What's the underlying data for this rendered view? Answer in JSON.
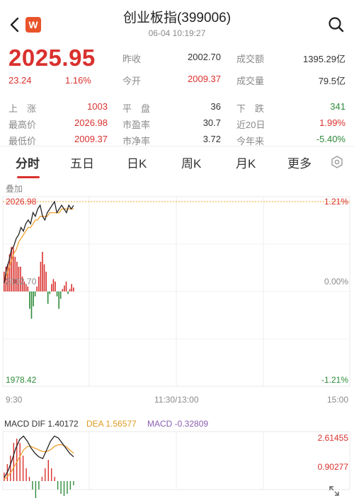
{
  "header": {
    "title": "创业板指(399006)",
    "subtitle": "06-04 10:19:27",
    "logo": "W",
    "back_icon": "chevron-left-icon",
    "search_icon": "search-icon"
  },
  "quote": {
    "price": "2025.95",
    "change": "23.24",
    "change_pct": "1.16%",
    "stats": [
      {
        "label": "昨收",
        "value": "2002.70",
        "color": "dark"
      },
      {
        "label": "成交额",
        "value": "1395.29亿",
        "color": "dark"
      },
      {
        "label": "今开",
        "value": "2009.37",
        "color": "red"
      },
      {
        "label": "成交量",
        "value": "79.5亿",
        "color": "dark"
      }
    ],
    "grid": [
      [
        {
          "label": "上　涨",
          "value": "1003",
          "color": "red"
        },
        {
          "label": "平　盘",
          "value": "36",
          "color": "dark"
        },
        {
          "label": "下　跌",
          "value": "341",
          "color": "green"
        }
      ],
      [
        {
          "label": "最高价",
          "value": "2026.98",
          "color": "red"
        },
        {
          "label": "市盈率",
          "value": "30.7",
          "color": "dark"
        },
        {
          "label": "近20日",
          "value": "1.99%",
          "color": "red"
        }
      ],
      [
        {
          "label": "最低价",
          "value": "2009.37",
          "color": "red"
        },
        {
          "label": "市净率",
          "value": "3.72",
          "color": "dark"
        },
        {
          "label": "今年来",
          "value": "-5.40%",
          "color": "green"
        }
      ]
    ]
  },
  "tabs": {
    "items": [
      "分时",
      "五日",
      "日K",
      "周K",
      "月K",
      "更多"
    ],
    "active": 0,
    "settings_icon": "hexagon-settings-icon"
  },
  "chart": {
    "overlay_label": "叠加",
    "y_top": "2026.98",
    "y_mid": "2002.70",
    "y_bottom": "1978.42",
    "pct_top": "1.21%",
    "pct_mid": "0.00%",
    "pct_bottom": "-1.21%",
    "time_start": "9:30",
    "time_mid": "11:30/13:00",
    "time_end": "15:00",
    "macd_dif": "MACD DIF 1.40172",
    "macd_dea": "DEA 1.56577",
    "macd_val": "MACD -0.32809",
    "macd_top": "2.61455",
    "macd_mid": "0.90277",
    "expand_icon": "expand-arrows-icon",
    "colors": {
      "up": "#d9312e",
      "down": "#2e8b3a",
      "price": "#222222",
      "avg": "#f0a030",
      "dea": "#f0a030",
      "macd": "#8a5fb0"
    }
  },
  "chart_data": {
    "type": "line",
    "price_series": [
      2005,
      2009,
      2011,
      2014,
      2015,
      2017,
      2018,
      2020,
      2019,
      2021,
      2022,
      2021,
      2024,
      2023,
      2025,
      2026,
      2023,
      2022,
      2024,
      2025,
      2026,
      2026.98,
      2024,
      2025,
      2026,
      2025,
      2024,
      2026,
      2025,
      2025.95
    ],
    "avg_series": [
      2006,
      2007,
      2009,
      2011,
      2013,
      2014,
      2016,
      2017,
      2018,
      2019,
      2020,
      2020,
      2021,
      2022,
      2022,
      2023,
      2023,
      2023,
      2023,
      2024,
      2024,
      2024,
      2024,
      2024,
      2025,
      2025,
      2025,
      2025,
      2025,
      2025
    ],
    "volume_bars": [
      0.4,
      0.5,
      0.55,
      0.75,
      0.9,
      0.9,
      0.7,
      0.6,
      0.5,
      0.5,
      0.3,
      0.2,
      0.15,
      0.1,
      -0.35,
      -0.55,
      -0.3,
      -0.1,
      0.1,
      0.3,
      0.6,
      0.8,
      0.55,
      0.4,
      -0.25,
      -0.05,
      0.15,
      0.25,
      0.2,
      -0.1,
      -0.35,
      -0.15,
      0.05,
      0.12,
      0.2,
      -0.05,
      0.05,
      0.15,
      0.08
    ],
    "macd_dif": [
      0.2,
      0.6,
      1.2,
      1.9,
      2.4,
      2.6,
      2.3,
      1.9,
      1.6,
      1.4,
      1.3,
      1.8,
      2.3,
      2.6,
      2.5,
      2.2,
      1.9,
      1.6,
      1.4
    ],
    "macd_dea": [
      0.1,
      0.3,
      0.6,
      1.0,
      1.4,
      1.8,
      2.0,
      2.0,
      1.9,
      1.8,
      1.7,
      1.7,
      1.8,
      2.0,
      2.1,
      2.1,
      2.0,
      1.8,
      1.6
    ],
    "macd_bars": [
      0.2,
      0.4,
      0.6,
      0.9,
      1.0,
      0.9,
      0.6,
      0.3,
      0.1,
      -0.2,
      -0.4,
      -0.2,
      0.1,
      0.3,
      0.5,
      0.3,
      0.1,
      -0.2,
      -0.3,
      -0.35,
      -0.3,
      -0.2,
      -0.1
    ],
    "ylim": [
      1978.42,
      2026.98
    ]
  }
}
